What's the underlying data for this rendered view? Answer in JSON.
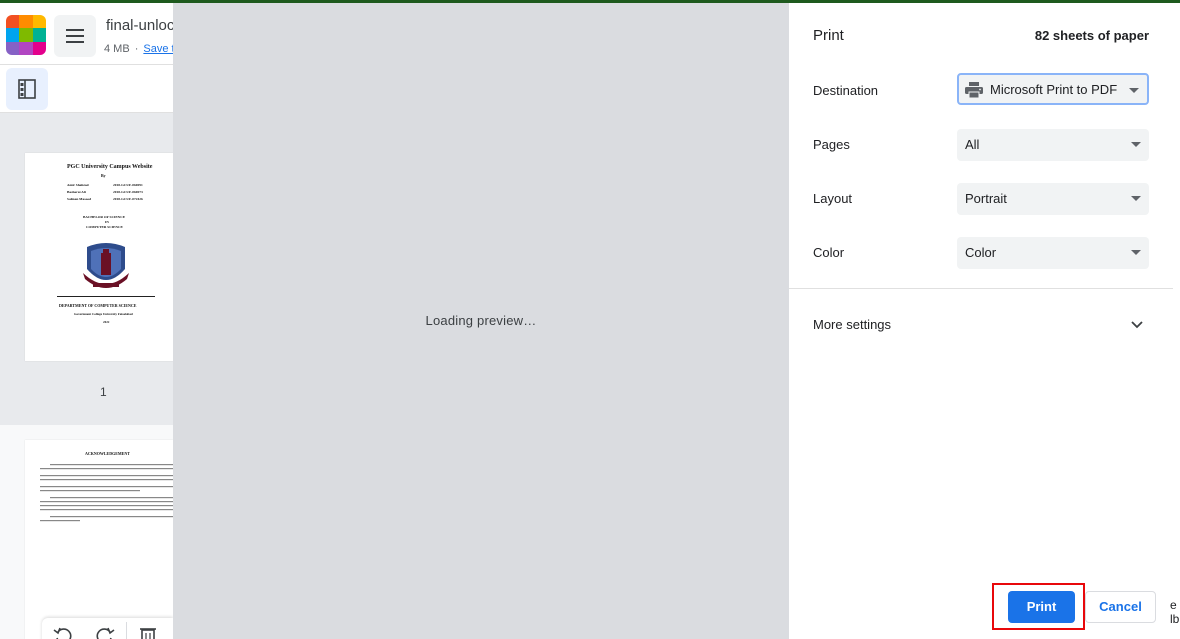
{
  "app": {
    "file_name": "final-unloc",
    "file_size": "4 MB",
    "save_link": "Save t",
    "logo_colors": [
      "#f25022",
      "#ff8c00",
      "#ffb900",
      "#00a4ef",
      "#7fba00",
      "#00b294",
      "#8661c5",
      "#b146c2",
      "#e3008c"
    ]
  },
  "thumbnails": {
    "page1": {
      "title": "PGC University Campus Website",
      "by": "By",
      "authors": [
        {
          "name": "Amir Shahzad",
          "id": "2018-GCUF-066991"
        },
        {
          "name": "Basharat Ali",
          "id": "2018-GCUF-066973"
        },
        {
          "name": "Salman Masood",
          "id": "2018-GCUF-072426"
        }
      ],
      "degree_line1": "BACHELOR OF SCIENCE",
      "degree_line2": "IN",
      "degree_line3": "COMPUTER SCIENCE",
      "department": "DEPARTMENT OF COMPUTER SCIENCE",
      "university": "Government College University Faisalabad",
      "year": "2022",
      "page_number": "1"
    },
    "page2": {
      "heading": "ACKNOWLEDGEMENT"
    }
  },
  "print_dialog": {
    "preview_status": "Loading preview…",
    "title": "Print",
    "sheet_count": "82 sheets of paper",
    "destination": {
      "label": "Destination",
      "value": "Microsoft Print to PDF"
    },
    "pages": {
      "label": "Pages",
      "value": "All"
    },
    "layout": {
      "label": "Layout",
      "value": "Portrait"
    },
    "color": {
      "label": "Color",
      "value": "Color"
    },
    "more_settings": "More settings",
    "print_button": "Print",
    "cancel_button": "Cancel",
    "highlight_color": "#e8080b",
    "accent_color": "#1a73e8"
  },
  "right_edge_clip": [
    "e",
    "lb"
  ]
}
